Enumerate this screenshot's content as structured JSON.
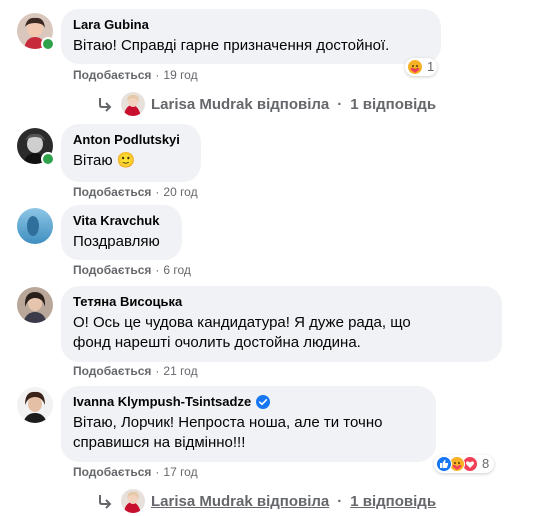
{
  "comments": [
    {
      "author": "Lara Gubina",
      "text": "Вітаю! Справді гарне призначення достойної.",
      "like_label": "Подобається",
      "time": "19 год",
      "reaction_count": "1"
    },
    {
      "author": "Anton Podlutskyi",
      "text": "Вітаю 🙂",
      "like_label": "Подобається",
      "time": "20 год"
    },
    {
      "author": "Vita Kravchuk",
      "text": "Поздравляю",
      "like_label": "Подобається",
      "time": "6 год"
    },
    {
      "author": "Тетяна Висоцька",
      "text_line1": "О! Ось це чудова кандидатура! Я дуже рада, що",
      "text_line2": "фонд нарешті очолить достойна людина.",
      "like_label": "Подобається",
      "time": "21 год"
    },
    {
      "author": "Ivanna Klympush-Tsintsadze",
      "text_line1": "Вітаю, Лорчик! Непроста ноша, але ти точно",
      "text_line2": "справишся на відмінно!!!",
      "like_label": "Подобається",
      "time": "17 год",
      "reaction_count": "8"
    }
  ],
  "replies": [
    {
      "text": "Larisa Mudrak відповіла",
      "count": "1 відповідь"
    },
    {
      "text": "Larisa Mudrak відповіла",
      "count": "1 відповідь"
    }
  ],
  "separator": "·",
  "colors": {
    "bubble": "#f0f2f5",
    "meta_text": "#65676b",
    "online": "#31a24c",
    "like_blue": "#1877f2",
    "love_red": "#f33e58",
    "care_yellow": "#f7b125",
    "verified_blue": "#1877f2"
  },
  "icons": {
    "reply_arrow": "reply-arrow-icon",
    "verified": "verified-badge-icon",
    "care": "care-reaction-icon",
    "like": "like-reaction-icon",
    "love": "love-reaction-icon"
  }
}
